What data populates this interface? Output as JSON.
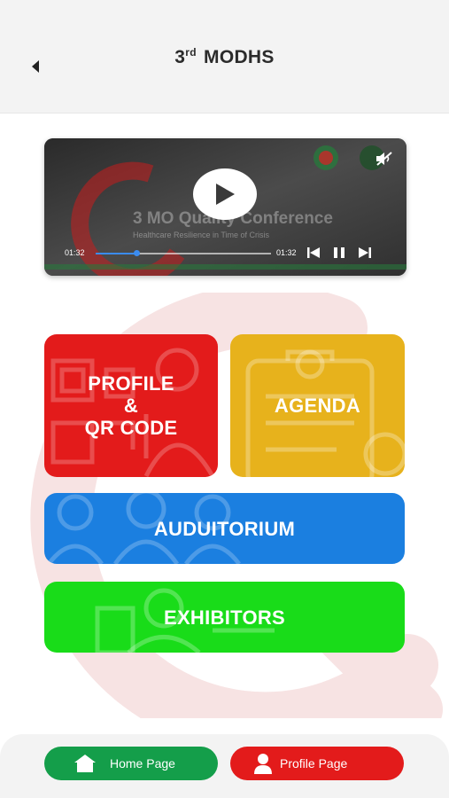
{
  "header": {
    "title_prefix": "3",
    "title_sup": "rd",
    "title_main": "MODHS",
    "back_icon": "back-arrow-icon"
  },
  "video": {
    "overlay_title": "Quality Conference",
    "overlay_prefix": "3 MO",
    "overlay_subtitle": "Healthcare Resilience in Time of Crisis",
    "current_time": "01:32",
    "duration": "01:32",
    "progress": 0.23,
    "muted": true,
    "state": "playing",
    "accent_color": "#3b8cf0"
  },
  "tiles": {
    "profile": {
      "line1": "PROFILE",
      "line2": "&",
      "line3": "QR CODE",
      "color": "#e31b1b"
    },
    "agenda": {
      "label": "AGENDA",
      "color": "#e7b21c"
    },
    "auditorium": {
      "label": "AUDUITORIUM",
      "color": "#1b7fe0"
    },
    "exhibitors": {
      "label": "EXHIBITORS",
      "color": "#19dc19"
    }
  },
  "bottom_nav": {
    "home": {
      "label": "Home Page",
      "icon": "home-icon",
      "color": "#149e4a"
    },
    "profile": {
      "label": "Profile Page",
      "icon": "user-icon",
      "color": "#e31b1b"
    }
  }
}
